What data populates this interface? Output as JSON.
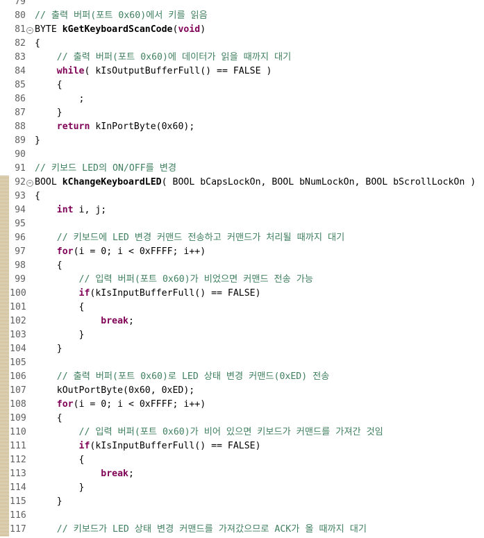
{
  "editor": {
    "lines": [
      {
        "n": "79",
        "text": "",
        "fold": false,
        "changed": false
      },
      {
        "n": "80",
        "text": "// 출력 버퍼(포트 0x60)에서 키를 읽음",
        "fold": false,
        "changed": false
      },
      {
        "n": "81",
        "text": "BYTE kGetKeyboardScanCode(void)",
        "fold": true,
        "changed": false
      },
      {
        "n": "82",
        "text": "{",
        "fold": false,
        "changed": false
      },
      {
        "n": "83",
        "text": "    // 출력 버퍼(포트 0x60)에 데이터가 읽을 때까지 대기",
        "fold": false,
        "changed": false
      },
      {
        "n": "84",
        "text": "    while( kIsOutputBufferFull() == FALSE )",
        "fold": false,
        "changed": false
      },
      {
        "n": "85",
        "text": "    {",
        "fold": false,
        "changed": false
      },
      {
        "n": "86",
        "text": "        ;",
        "fold": false,
        "changed": false
      },
      {
        "n": "87",
        "text": "    }",
        "fold": false,
        "changed": false
      },
      {
        "n": "88",
        "text": "    return kInPortByte(0x60);",
        "fold": false,
        "changed": false
      },
      {
        "n": "89",
        "text": "}",
        "fold": false,
        "changed": false
      },
      {
        "n": "90",
        "text": "",
        "fold": false,
        "changed": false
      },
      {
        "n": "91",
        "text": "// 키보드 LED의 ON/OFF를 변경",
        "fold": false,
        "changed": false
      },
      {
        "n": "92",
        "text": "BOOL kChangeKeyboardLED( BOOL bCapsLockOn, BOOL bNumLockOn, BOOL bScrollLockOn )",
        "fold": true,
        "changed": true
      },
      {
        "n": "93",
        "text": "{",
        "fold": false,
        "changed": true
      },
      {
        "n": "94",
        "text": "    int i, j;",
        "fold": false,
        "changed": true
      },
      {
        "n": "95",
        "text": "",
        "fold": false,
        "changed": true
      },
      {
        "n": "96",
        "text": "    // 키보드에 LED 변경 커맨드 전송하고 커맨드가 처리될 때까지 대기",
        "fold": false,
        "changed": true
      },
      {
        "n": "97",
        "text": "    for(i = 0; i < 0xFFFF; i++)",
        "fold": false,
        "changed": true
      },
      {
        "n": "98",
        "text": "    {",
        "fold": false,
        "changed": true
      },
      {
        "n": "99",
        "text": "        // 입력 버퍼(포트 0x60)가 비었으면 커맨드 전송 가능",
        "fold": false,
        "changed": true
      },
      {
        "n": "100",
        "text": "        if(kIsInputBufferFull() == FALSE)",
        "fold": false,
        "changed": true
      },
      {
        "n": "101",
        "text": "        {",
        "fold": false,
        "changed": true
      },
      {
        "n": "102",
        "text": "            break;",
        "fold": false,
        "changed": true
      },
      {
        "n": "103",
        "text": "        }",
        "fold": false,
        "changed": true
      },
      {
        "n": "104",
        "text": "    }",
        "fold": false,
        "changed": true
      },
      {
        "n": "105",
        "text": "",
        "fold": false,
        "changed": true
      },
      {
        "n": "106",
        "text": "    // 출력 버퍼(포트 0x60)로 LED 상태 변경 커맨드(0xED) 전송",
        "fold": false,
        "changed": true
      },
      {
        "n": "107",
        "text": "    kOutPortByte(0x60, 0xED);",
        "fold": false,
        "changed": true
      },
      {
        "n": "108",
        "text": "    for(i = 0; i < 0xFFFF; i++)",
        "fold": false,
        "changed": true
      },
      {
        "n": "109",
        "text": "    {",
        "fold": false,
        "changed": true
      },
      {
        "n": "110",
        "text": "        // 입력 버퍼(포트 0x60)가 비어 있으면 키보드가 커맨드를 가져간 것임",
        "fold": false,
        "changed": true
      },
      {
        "n": "111",
        "text": "        if(kIsInputBufferFull() == FALSE)",
        "fold": false,
        "changed": true
      },
      {
        "n": "112",
        "text": "        {",
        "fold": false,
        "changed": true
      },
      {
        "n": "113",
        "text": "            break;",
        "fold": false,
        "changed": true
      },
      {
        "n": "114",
        "text": "        }",
        "fold": false,
        "changed": true
      },
      {
        "n": "115",
        "text": "    }",
        "fold": false,
        "changed": true
      },
      {
        "n": "116",
        "text": "",
        "fold": false,
        "changed": true
      },
      {
        "n": "117",
        "text": "    // 키보드가 LED 상태 변경 커맨드를 가져갔으므로 ACK가 올 때까지 대기",
        "fold": false,
        "changed": true
      }
    ],
    "fold_glyph": "⊖",
    "colors": {
      "keyword": "#7f0055",
      "comment": "#3f7f5f",
      "line_number": "#5f5f5f",
      "change_marker": "#c8b68f"
    }
  }
}
